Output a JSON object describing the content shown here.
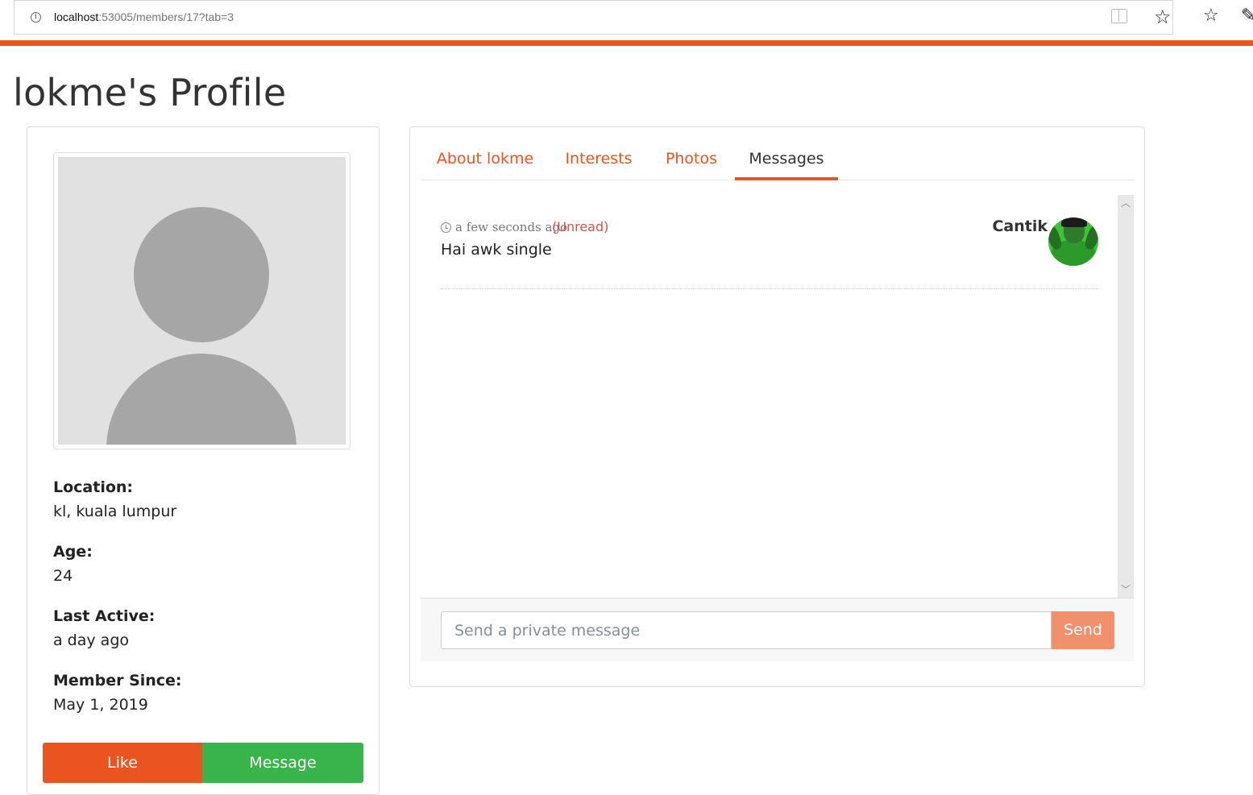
{
  "browser": {
    "url_host": "localhost",
    "url_rest": ":53005/members/17?tab=3"
  },
  "colors": {
    "accent": "#e95420",
    "success": "#38b44a",
    "unread": "#d9534f"
  },
  "page": {
    "title": "lokme's Profile"
  },
  "profile": {
    "fields": [
      {
        "label": "Location:",
        "value": "kl, kuala lumpur"
      },
      {
        "label": "Age:",
        "value": "24"
      },
      {
        "label": "Last Active:",
        "value": "a day ago"
      },
      {
        "label": "Member Since:",
        "value": "May 1, 2019"
      }
    ],
    "buttons": {
      "like": "Like",
      "message": "Message"
    }
  },
  "tabs": [
    {
      "label": "About lokme",
      "active": false
    },
    {
      "label": "Interests",
      "active": false
    },
    {
      "label": "Photos",
      "active": false
    },
    {
      "label": "Messages",
      "active": true
    }
  ],
  "messages": [
    {
      "time": "a few seconds ago",
      "status": "(Unread)",
      "content": "Hai awk single",
      "sender": "Cantik"
    }
  ],
  "composer": {
    "placeholder": "Send a private message",
    "send_label": "Send"
  },
  "icons": {
    "info": "info-icon",
    "reader": "reading-view-icon",
    "favorite": "star-icon",
    "favorites_hub": "favorites-list-icon",
    "clock": "clock-icon"
  }
}
